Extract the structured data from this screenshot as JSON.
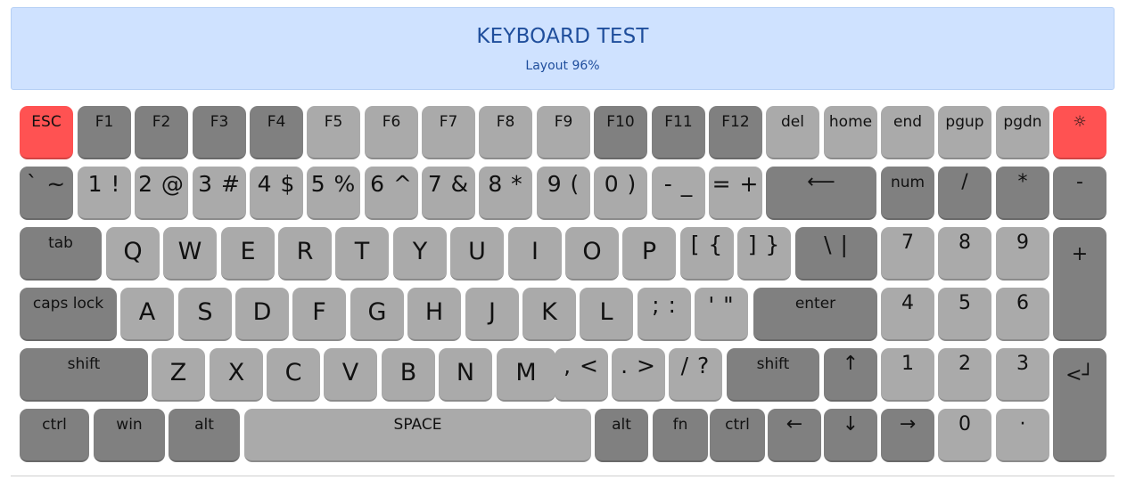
{
  "header": {
    "title": "KEYBOARD TEST",
    "subtitle": "Layout 96%"
  },
  "colors": {
    "light_key": "#aaaaaa",
    "dark_key": "#808080",
    "red_key": "#ff5252",
    "header_bg": "#cfe2ff",
    "header_text": "#1f4e9c"
  },
  "keyboard": {
    "rows": [
      [
        {
          "name": "key-esc",
          "label": "ESC",
          "style": "red"
        },
        {
          "name": "key-f1",
          "label": "F1",
          "style": "dark"
        },
        {
          "name": "key-f2",
          "label": "F2",
          "style": "dark"
        },
        {
          "name": "key-f3",
          "label": "F3",
          "style": "dark"
        },
        {
          "name": "key-f4",
          "label": "F4",
          "style": "dark"
        },
        {
          "name": "key-f5",
          "label": "F5",
          "style": "light"
        },
        {
          "name": "key-f6",
          "label": "F6",
          "style": "light"
        },
        {
          "name": "key-f7",
          "label": "F7",
          "style": "light"
        },
        {
          "name": "key-f8",
          "label": "F8",
          "style": "light"
        },
        {
          "name": "key-f9",
          "label": "F9",
          "style": "light"
        },
        {
          "name": "key-f10",
          "label": "F10",
          "style": "dark"
        },
        {
          "name": "key-f11",
          "label": "F11",
          "style": "dark"
        },
        {
          "name": "key-f12",
          "label": "F12",
          "style": "dark"
        },
        {
          "name": "key-del",
          "label": "del",
          "style": "light"
        },
        {
          "name": "key-home",
          "label": "home",
          "style": "light"
        },
        {
          "name": "key-end",
          "label": "end",
          "style": "light"
        },
        {
          "name": "key-pgup",
          "label": "pgup",
          "style": "light"
        },
        {
          "name": "key-pgdn",
          "label": "pgdn",
          "style": "light"
        },
        {
          "name": "brightness-icon",
          "label": "☼",
          "style": "red"
        }
      ],
      [
        {
          "name": "key-backtick",
          "label": "` ~",
          "style": "dark"
        },
        {
          "name": "key-1",
          "label": "1 !",
          "style": "light"
        },
        {
          "name": "key-2",
          "label": "2 @",
          "style": "light"
        },
        {
          "name": "key-3",
          "label": "3 #",
          "style": "light"
        },
        {
          "name": "key-4",
          "label": "4 $",
          "style": "light"
        },
        {
          "name": "key-5",
          "label": "5 %",
          "style": "light"
        },
        {
          "name": "key-6",
          "label": "6 ^",
          "style": "light"
        },
        {
          "name": "key-7",
          "label": "7 &",
          "style": "light"
        },
        {
          "name": "key-8",
          "label": "8 *",
          "style": "light"
        },
        {
          "name": "key-9",
          "label": "9 (",
          "style": "light"
        },
        {
          "name": "key-0",
          "label": "0 )",
          "style": "light"
        },
        {
          "name": "key-minus",
          "label": "- _",
          "style": "light"
        },
        {
          "name": "key-equals",
          "label": "= +",
          "style": "light"
        },
        {
          "name": "key-backspace",
          "label": "⟵",
          "style": "dark"
        },
        {
          "name": "key-numlock",
          "label": "num",
          "style": "dark"
        },
        {
          "name": "key-num-slash",
          "label": "/",
          "style": "dark"
        },
        {
          "name": "key-num-asterisk",
          "label": "*",
          "style": "dark"
        },
        {
          "name": "key-num-minus",
          "label": "-",
          "style": "dark"
        }
      ],
      [
        {
          "name": "key-tab",
          "label": "tab",
          "style": "dark"
        },
        {
          "name": "key-q",
          "label": "Q",
          "style": "light"
        },
        {
          "name": "key-w",
          "label": "W",
          "style": "light"
        },
        {
          "name": "key-e",
          "label": "E",
          "style": "light"
        },
        {
          "name": "key-r",
          "label": "R",
          "style": "light"
        },
        {
          "name": "key-t",
          "label": "T",
          "style": "light"
        },
        {
          "name": "key-y",
          "label": "Y",
          "style": "light"
        },
        {
          "name": "key-u",
          "label": "U",
          "style": "light"
        },
        {
          "name": "key-i",
          "label": "I",
          "style": "light"
        },
        {
          "name": "key-o",
          "label": "O",
          "style": "light"
        },
        {
          "name": "key-p",
          "label": "P",
          "style": "light"
        },
        {
          "name": "key-bracket-left",
          "label": "[ {",
          "style": "light"
        },
        {
          "name": "key-bracket-right",
          "label": "] }",
          "style": "light"
        },
        {
          "name": "key-backslash",
          "label": "\\ |",
          "style": "dark"
        },
        {
          "name": "key-num-7",
          "label": "7",
          "style": "light"
        },
        {
          "name": "key-num-8",
          "label": "8",
          "style": "light"
        },
        {
          "name": "key-num-9",
          "label": "9",
          "style": "light"
        },
        {
          "name": "key-num-plus",
          "label": "+",
          "style": "dark"
        }
      ],
      [
        {
          "name": "key-capslock",
          "label": "caps lock",
          "style": "dark"
        },
        {
          "name": "key-a",
          "label": "A",
          "style": "light"
        },
        {
          "name": "key-s",
          "label": "S",
          "style": "light"
        },
        {
          "name": "key-d",
          "label": "D",
          "style": "light"
        },
        {
          "name": "key-f",
          "label": "F",
          "style": "light"
        },
        {
          "name": "key-g",
          "label": "G",
          "style": "light"
        },
        {
          "name": "key-h",
          "label": "H",
          "style": "light"
        },
        {
          "name": "key-j",
          "label": "J",
          "style": "light"
        },
        {
          "name": "key-k",
          "label": "K",
          "style": "light"
        },
        {
          "name": "key-l",
          "label": "L",
          "style": "light"
        },
        {
          "name": "key-semicolon",
          "label": "; :",
          "style": "light"
        },
        {
          "name": "key-quote",
          "label": "' \"",
          "style": "light"
        },
        {
          "name": "key-enter",
          "label": "enter",
          "style": "dark"
        },
        {
          "name": "key-num-4",
          "label": "4",
          "style": "light"
        },
        {
          "name": "key-num-5",
          "label": "5",
          "style": "light"
        },
        {
          "name": "key-num-6",
          "label": "6",
          "style": "light"
        },
        {
          "name": "key-num-plus-lower",
          "label": "",
          "style": "dark"
        }
      ],
      [
        {
          "name": "key-shift-left",
          "label": "shift",
          "style": "dark"
        },
        {
          "name": "key-z",
          "label": "Z",
          "style": "light"
        },
        {
          "name": "key-x",
          "label": "X",
          "style": "light"
        },
        {
          "name": "key-c",
          "label": "C",
          "style": "light"
        },
        {
          "name": "key-v",
          "label": "V",
          "style": "light"
        },
        {
          "name": "key-b",
          "label": "B",
          "style": "light"
        },
        {
          "name": "key-n",
          "label": "N",
          "style": "light"
        },
        {
          "name": "key-m",
          "label": "M",
          "style": "light"
        },
        {
          "name": "key-comma",
          "label": ", <",
          "style": "light"
        },
        {
          "name": "key-period",
          "label": ". >",
          "style": "light"
        },
        {
          "name": "key-slash",
          "label": "/ ?",
          "style": "light"
        },
        {
          "name": "key-shift-right",
          "label": "shift",
          "style": "dark"
        },
        {
          "name": "arrow-up-icon",
          "label": "↑",
          "style": "dark"
        },
        {
          "name": "key-num-1",
          "label": "1",
          "style": "light"
        },
        {
          "name": "key-num-2",
          "label": "2",
          "style": "light"
        },
        {
          "name": "key-num-3",
          "label": "3",
          "style": "light"
        },
        {
          "name": "key-num-enter",
          "label": "<┘",
          "style": "dark"
        }
      ],
      [
        {
          "name": "key-ctrl-left",
          "label": "ctrl",
          "style": "dark"
        },
        {
          "name": "key-win",
          "label": "win",
          "style": "dark"
        },
        {
          "name": "key-alt-left",
          "label": "alt",
          "style": "dark"
        },
        {
          "name": "key-space",
          "label": "SPACE",
          "style": "light"
        },
        {
          "name": "key-alt-right",
          "label": "alt",
          "style": "dark"
        },
        {
          "name": "key-fn",
          "label": "fn",
          "style": "dark"
        },
        {
          "name": "key-ctrl-right",
          "label": "ctrl",
          "style": "dark"
        },
        {
          "name": "arrow-left-icon",
          "label": "←",
          "style": "dark"
        },
        {
          "name": "arrow-down-icon",
          "label": "↓",
          "style": "dark"
        },
        {
          "name": "arrow-right-icon",
          "label": "→",
          "style": "dark"
        },
        {
          "name": "key-num-0",
          "label": "0",
          "style": "light"
        },
        {
          "name": "key-num-dot",
          "label": "·",
          "style": "light"
        },
        {
          "name": "key-num-enter-lower",
          "label": "",
          "style": "dark"
        }
      ]
    ]
  }
}
